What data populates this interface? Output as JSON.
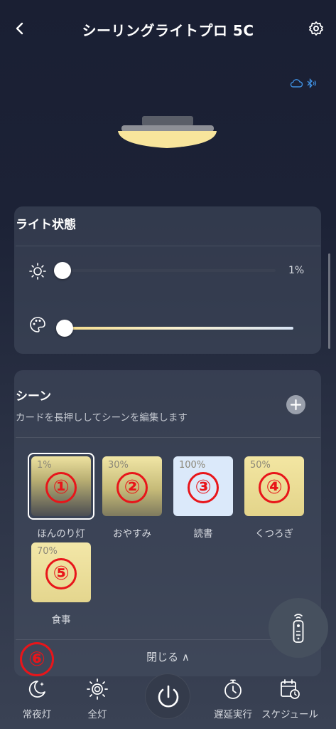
{
  "header": {
    "title": "シーリングライトプロ 5C",
    "back_icon": "chevron-left-icon",
    "settings_icon": "gear-icon"
  },
  "connectivity": {
    "icons": [
      "cloud-icon",
      "bluetooth-icon"
    ],
    "color": "#3f8fe0"
  },
  "light_status": {
    "title": "ライト状態",
    "brightness": {
      "icon": "sun-icon",
      "value": 1,
      "label": "1%"
    },
    "color_temperature": {
      "icon": "palette-icon",
      "value": 0
    }
  },
  "scenes": {
    "title": "シーン",
    "subtitle": "カードを長押ししてシーンを編集します",
    "add_icon": "plus-icon",
    "items": [
      {
        "percent": "1%",
        "marker": "①",
        "label": "ほんのり灯",
        "selected": true
      },
      {
        "percent": "30%",
        "marker": "②",
        "label": "おやすみ",
        "selected": false
      },
      {
        "percent": "100%",
        "marker": "③",
        "label": "読書",
        "selected": false
      },
      {
        "percent": "50%",
        "marker": "④",
        "label": "くつろぎ",
        "selected": false
      },
      {
        "percent": "70%",
        "marker": "⑤",
        "label": "食事",
        "selected": false
      }
    ],
    "collapse_label": "閉じる ∧"
  },
  "annotation_6": "⑥",
  "bottom_bar": {
    "tabs": [
      {
        "icon": "moon-icon",
        "label": "常夜灯"
      },
      {
        "icon": "sun-full-icon",
        "label": "全灯"
      },
      {
        "icon": "power-icon",
        "label": ""
      },
      {
        "icon": "timer-icon",
        "label": "遅延実行"
      },
      {
        "icon": "calendar-clock-icon",
        "label": "スケジュール"
      }
    ]
  },
  "colors": {
    "annotation_red": "#e8151a",
    "warm_light": "#f5e6a0"
  }
}
